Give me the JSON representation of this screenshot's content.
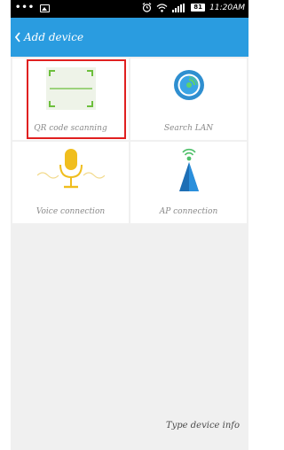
{
  "status_bar": {
    "left_icons": [
      "more-dots-icon",
      "image-notification-icon"
    ],
    "right_icons": [
      "alarm-icon",
      "wifi-icon",
      "signal-icon"
    ],
    "battery": "81",
    "time": "11:20AM"
  },
  "header": {
    "back_icon": "chevron-left-icon",
    "title": "Add device",
    "accent_color": "#2a9ce0"
  },
  "tiles": [
    {
      "label": "QR code scanning",
      "icon": "qr-scan-icon",
      "selected": true
    },
    {
      "label": "Search LAN",
      "icon": "lan-search-icon",
      "selected": false
    },
    {
      "label": "Voice connection",
      "icon": "microphone-icon",
      "selected": false
    },
    {
      "label": "AP connection",
      "icon": "ap-tower-icon",
      "selected": false
    }
  ],
  "footer": {
    "type_info_label": "Type device info"
  },
  "colors": {
    "selection_outline": "#e02020",
    "background": "#f0f0f0"
  }
}
